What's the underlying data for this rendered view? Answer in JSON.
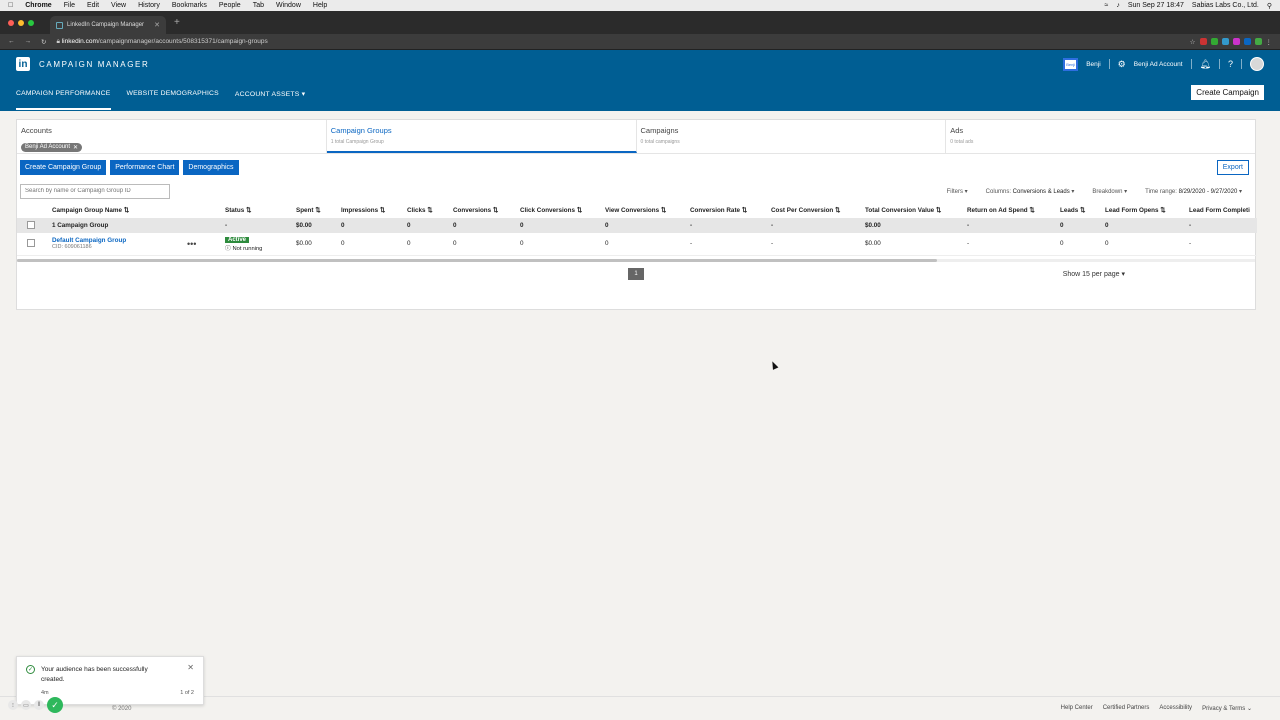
{
  "menubar": {
    "items": [
      "Chrome",
      "File",
      "Edit",
      "View",
      "History",
      "Bookmarks",
      "People",
      "Tab",
      "Window",
      "Help"
    ],
    "datetime": "Sun Sep 27  18:47",
    "company": "Sabias Labs Co., Ltd."
  },
  "browser": {
    "tab_title": "LinkedIn Campaign Manager",
    "url_host": "linkedin.com",
    "url_path": "/campaignmanager/accounts/508315371/campaign-groups"
  },
  "header": {
    "logo_text": "in",
    "brand": "CAMPAIGN MANAGER",
    "account_badge": "Benji",
    "account_name": "Benji",
    "ad_account": "Benji Ad Account",
    "nav": [
      "CAMPAIGN PERFORMANCE",
      "WEBSITE DEMOGRAPHICS",
      "ACCOUNT ASSETS"
    ],
    "create_campaign": "Create Campaign"
  },
  "crumbs": [
    {
      "title": "Accounts",
      "chip": "Benji Ad Account"
    },
    {
      "title": "Campaign Groups",
      "sub": "1 total Campaign Group"
    },
    {
      "title": "Campaigns",
      "sub": "0 total campaigns"
    },
    {
      "title": "Ads",
      "sub": "0 total ads"
    }
  ],
  "buttons": {
    "create_group": "Create Campaign Group",
    "performance_chart": "Performance Chart",
    "demographics": "Demographics",
    "export": "Export"
  },
  "filters": {
    "search_placeholder": "Search by name or Campaign Group ID",
    "filters": "Filters",
    "columns_label": "Columns:",
    "columns_value": "Conversions & Leads",
    "breakdown": "Breakdown",
    "time_label": "Time range:",
    "time_value": "8/29/2020 - 9/27/2020"
  },
  "table": {
    "headers": [
      "Campaign Group Name",
      "Status",
      "Spent",
      "Impressions",
      "Clicks",
      "Conversions",
      "Click Conversions",
      "View Conversions",
      "Conversion Rate",
      "Cost Per Conversion",
      "Total Conversion Value",
      "Return on Ad Spend",
      "Leads",
      "Lead Form Opens",
      "Lead Form Completi"
    ],
    "summary": [
      "1 Campaign Group",
      "-",
      "$0.00",
      "0",
      "0",
      "0",
      "0",
      "0",
      "-",
      "-",
      "$0.00",
      "-",
      "0",
      "0",
      "-"
    ],
    "row": {
      "name": "Default Campaign Group",
      "cid": "CID: 609061186",
      "status": "Active",
      "status_sub": "Not running",
      "values": [
        "$0.00",
        "0",
        "0",
        "0",
        "0",
        "0",
        "-",
        "-",
        "$0.00",
        "-",
        "0",
        "0",
        "-"
      ]
    }
  },
  "pager": {
    "page": "1",
    "per_page": "Show 15 per page"
  },
  "toast": {
    "message": "Your audience has been successfully created.",
    "time": "4m",
    "count": "1 of 2"
  },
  "footer": {
    "copy": "© 2020",
    "links": [
      "Help Center",
      "Certified Partners",
      "Accessibility",
      "Privacy & Terms"
    ]
  }
}
